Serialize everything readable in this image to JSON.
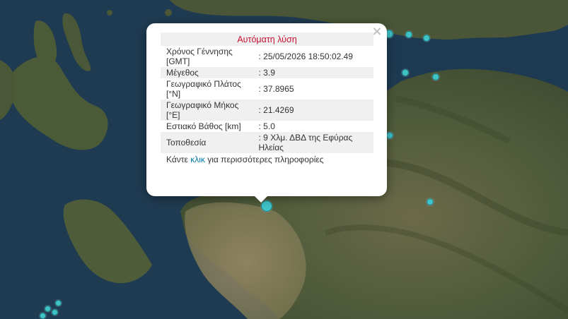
{
  "popup": {
    "header": "Αυτόματη λύση",
    "close_symbol": "×",
    "rows": [
      {
        "label": "Χρόνος Γέννησης [GMT]",
        "value": ": 25/05/2026 18:50:02.49"
      },
      {
        "label": "Μέγεθος",
        "value": ": 3.9"
      },
      {
        "label": "Γεωγραφικό Πλάτος [°N]",
        "value": ": 37.8965"
      },
      {
        "label": "Γεωγραφικό Μήκος [°E]",
        "value": ": 21.4269"
      },
      {
        "label": "Εστιακό Βάθος [km]",
        "value": ": 5.0"
      },
      {
        "label": "Τοποθεσία",
        "value": ": 9 Χλμ. ΔΒΔ της Εφύρας Ηλείας"
      }
    ],
    "footer_before": "Κάντε ",
    "footer_link": "κλικ",
    "footer_after": " για περισσότερες πληροφορίες"
  },
  "colors": {
    "sea": "#1e3a4f",
    "land": "#4c5a3a",
    "marker_fill": "#3fc3c7",
    "header_text": "#c8102e",
    "link": "#0078a8"
  }
}
